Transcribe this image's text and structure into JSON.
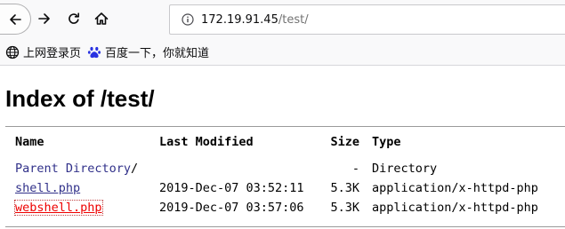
{
  "browser": {
    "url_host": "172.19.91.45",
    "url_path": "/test/",
    "icons": {
      "back": "arrow-left-icon",
      "forward": "arrow-right-icon",
      "reload": "reload-icon",
      "home": "home-icon",
      "site_info": "info-icon"
    }
  },
  "bookmarks": [
    {
      "label": "上网登录页",
      "icon": "globe-icon"
    },
    {
      "label": "百度一下，你就知道",
      "icon": "baidu-paw-icon"
    }
  ],
  "page": {
    "title": "Index of /test/",
    "columns": {
      "name": "Name",
      "modified": "Last Modified",
      "size": "Size",
      "type": "Type"
    },
    "parent": {
      "name": "Parent Directory",
      "slash": "/",
      "size": "-",
      "type": "Directory"
    },
    "files": [
      {
        "name": "shell.php",
        "modified": "2019-Dec-07 03:52:11",
        "size": "5.3K",
        "type": "application/x-httpd-php"
      },
      {
        "name": "webshell.php",
        "modified": "2019-Dec-07 03:57:06",
        "size": "5.3K",
        "type": "application/x-httpd-php"
      }
    ]
  },
  "colors": {
    "link": "#31318a",
    "active_link": "#ee0000",
    "toolbar_bg": "#f9f9fa"
  }
}
